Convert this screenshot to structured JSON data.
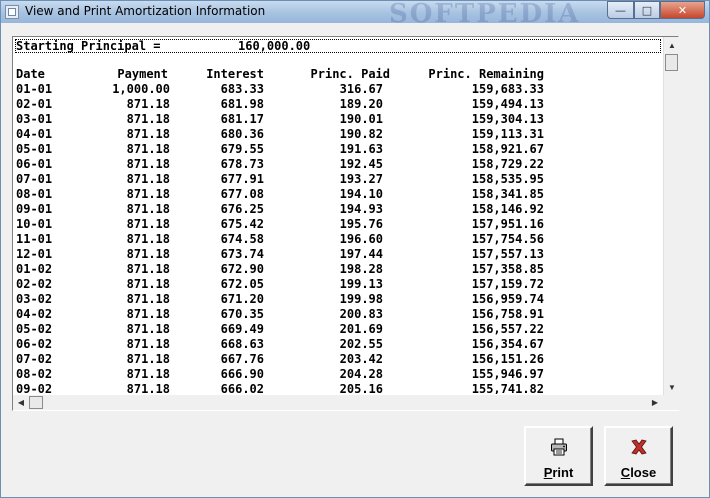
{
  "window": {
    "title": "View and Print Amortization Information",
    "watermark": "SOFTPEDIA",
    "controls": {
      "minimize": "—",
      "maximize": "□",
      "close": "✕"
    }
  },
  "report": {
    "principal_label": "Starting Principal =",
    "principal_value": "160,000.00",
    "headers": {
      "date": "Date",
      "payment": "Payment",
      "interest": "Interest",
      "principal_paid": "Princ. Paid",
      "principal_remaining": "Princ. Remaining"
    },
    "rows": [
      {
        "date": "01-01",
        "payment": "1,000.00",
        "interest": "683.33",
        "paid": "316.67",
        "remaining": "159,683.33"
      },
      {
        "date": "02-01",
        "payment": "871.18",
        "interest": "681.98",
        "paid": "189.20",
        "remaining": "159,494.13"
      },
      {
        "date": "03-01",
        "payment": "871.18",
        "interest": "681.17",
        "paid": "190.01",
        "remaining": "159,304.13"
      },
      {
        "date": "04-01",
        "payment": "871.18",
        "interest": "680.36",
        "paid": "190.82",
        "remaining": "159,113.31"
      },
      {
        "date": "05-01",
        "payment": "871.18",
        "interest": "679.55",
        "paid": "191.63",
        "remaining": "158,921.67"
      },
      {
        "date": "06-01",
        "payment": "871.18",
        "interest": "678.73",
        "paid": "192.45",
        "remaining": "158,729.22"
      },
      {
        "date": "07-01",
        "payment": "871.18",
        "interest": "677.91",
        "paid": "193.27",
        "remaining": "158,535.95"
      },
      {
        "date": "08-01",
        "payment": "871.18",
        "interest": "677.08",
        "paid": "194.10",
        "remaining": "158,341.85"
      },
      {
        "date": "09-01",
        "payment": "871.18",
        "interest": "676.25",
        "paid": "194.93",
        "remaining": "158,146.92"
      },
      {
        "date": "10-01",
        "payment": "871.18",
        "interest": "675.42",
        "paid": "195.76",
        "remaining": "157,951.16"
      },
      {
        "date": "11-01",
        "payment": "871.18",
        "interest": "674.58",
        "paid": "196.60",
        "remaining": "157,754.56"
      },
      {
        "date": "12-01",
        "payment": "871.18",
        "interest": "673.74",
        "paid": "197.44",
        "remaining": "157,557.13"
      },
      {
        "date": "01-02",
        "payment": "871.18",
        "interest": "672.90",
        "paid": "198.28",
        "remaining": "157,358.85"
      },
      {
        "date": "02-02",
        "payment": "871.18",
        "interest": "672.05",
        "paid": "199.13",
        "remaining": "157,159.72"
      },
      {
        "date": "03-02",
        "payment": "871.18",
        "interest": "671.20",
        "paid": "199.98",
        "remaining": "156,959.74"
      },
      {
        "date": "04-02",
        "payment": "871.18",
        "interest": "670.35",
        "paid": "200.83",
        "remaining": "156,758.91"
      },
      {
        "date": "05-02",
        "payment": "871.18",
        "interest": "669.49",
        "paid": "201.69",
        "remaining": "156,557.22"
      },
      {
        "date": "06-02",
        "payment": "871.18",
        "interest": "668.63",
        "paid": "202.55",
        "remaining": "156,354.67"
      },
      {
        "date": "07-02",
        "payment": "871.18",
        "interest": "667.76",
        "paid": "203.42",
        "remaining": "156,151.26"
      },
      {
        "date": "08-02",
        "payment": "871.18",
        "interest": "666.90",
        "paid": "204.28",
        "remaining": "155,946.97"
      },
      {
        "date": "09-02",
        "payment": "871.18",
        "interest": "666.02",
        "paid": "205.16",
        "remaining": "155,741.82"
      }
    ]
  },
  "buttons": {
    "print": {
      "label": "Print",
      "icon": "printer-icon"
    },
    "close": {
      "label": "Close",
      "icon": "close-x-icon",
      "accent": "#c0302a"
    }
  }
}
